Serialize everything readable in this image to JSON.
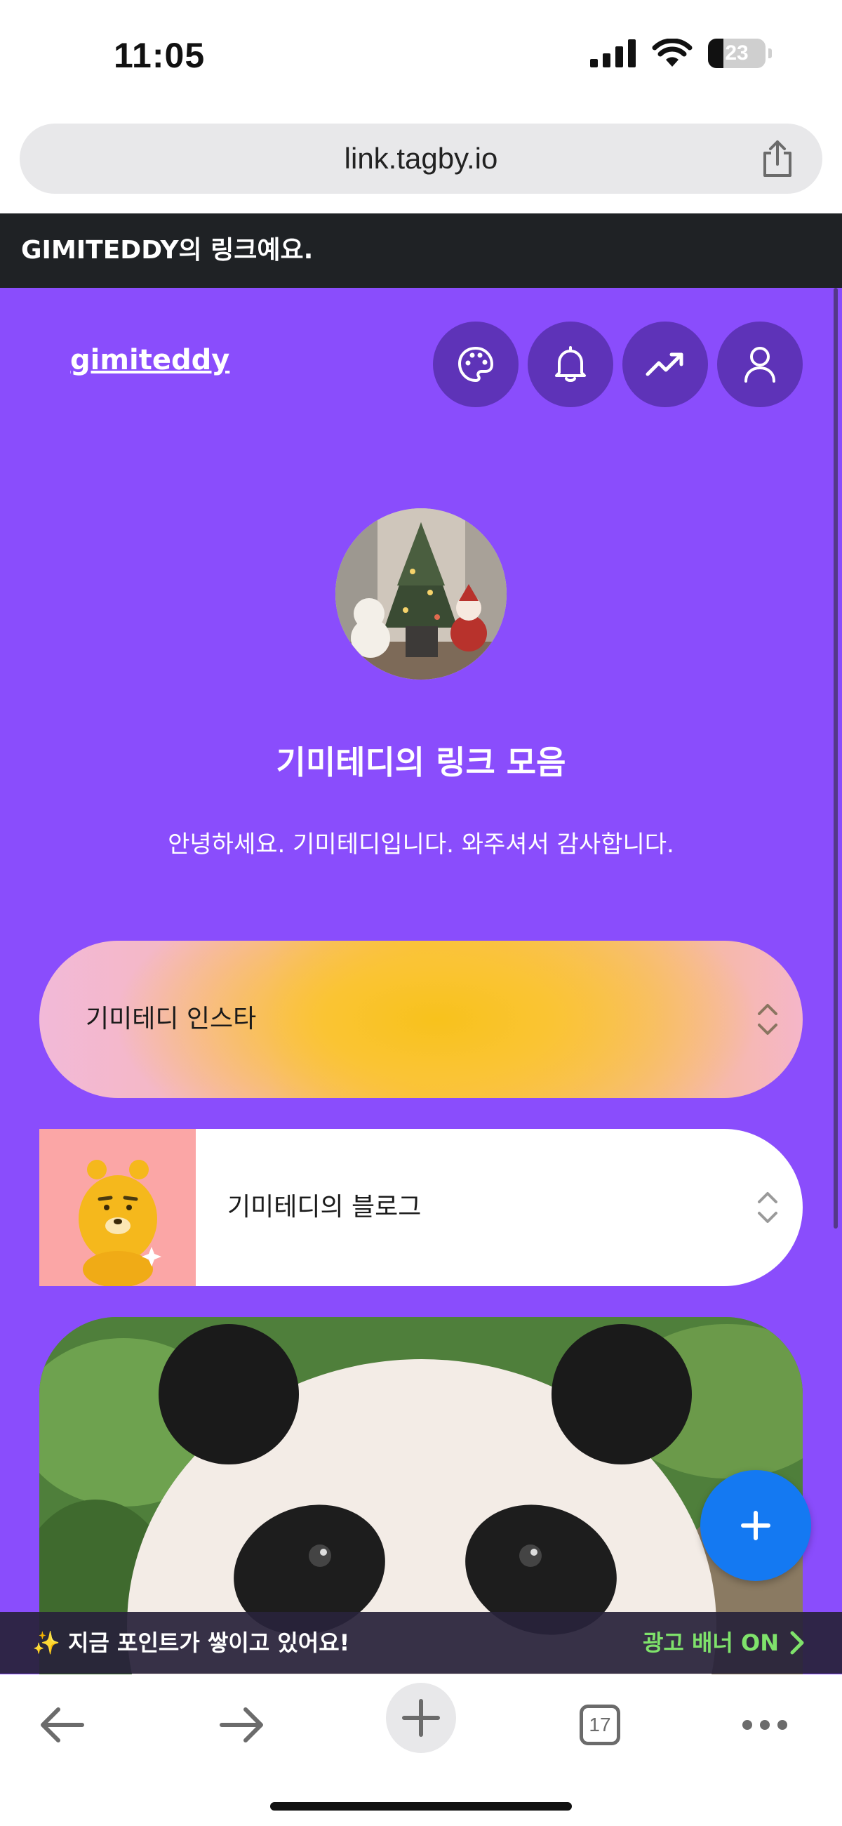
{
  "status_bar": {
    "time": "11:05",
    "battery": "23"
  },
  "browser": {
    "url": "link.tagby.io",
    "tabs_count": "17"
  },
  "owner_banner": {
    "text": "GIMITEDDY의 링크예요."
  },
  "header": {
    "username": "gimiteddy"
  },
  "profile": {
    "title": "기미테디의 링크 모음",
    "bio": "안녕하세요. 기미테디입니다. 와주셔서 감사합니다."
  },
  "links": [
    {
      "label": "기미테디 인스타"
    },
    {
      "label": "기미테디의 블로그"
    }
  ],
  "ad_banner": {
    "icon": "sparkles",
    "text": "지금 포인트가 쌓이고 있어요!",
    "cta": "광고 배너 ON"
  },
  "colors": {
    "page_background": "#8a4dfc",
    "action_button": "#5e33b8",
    "fab": "#1479f2",
    "ad_cta": "#7fe26b"
  },
  "icons": [
    "palette-icon",
    "bell-icon",
    "trending-up-icon",
    "user-icon",
    "share-icon",
    "plus-icon",
    "back-arrow-icon",
    "forward-arrow-icon",
    "more-icon"
  ]
}
